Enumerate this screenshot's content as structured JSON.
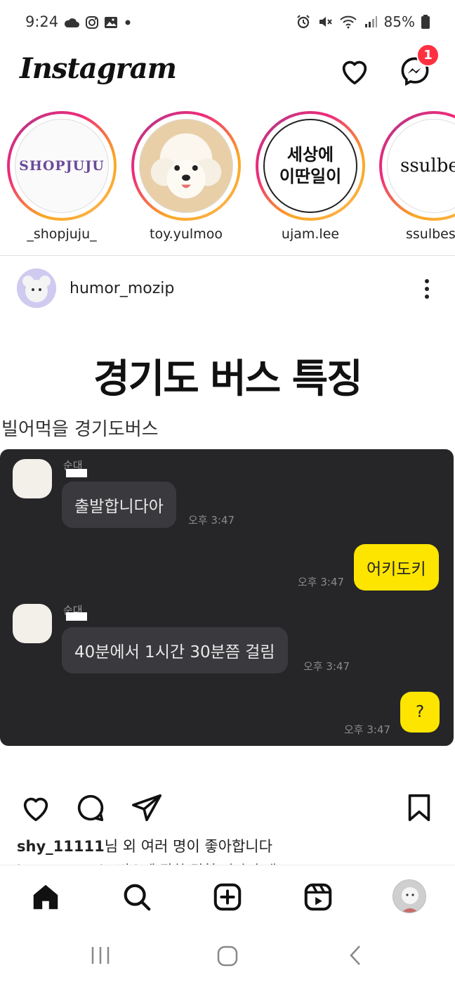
{
  "status_bar": {
    "time": "9:24",
    "battery": "85%",
    "left_icons": [
      "cloud-icon",
      "instagram-notification-icon",
      "gallery-icon",
      "dot-icon"
    ],
    "right_icons": [
      "alarm-icon",
      "mute-icon",
      "wifi-icon",
      "signal-icon",
      "battery-icon"
    ]
  },
  "header": {
    "brand": "Instagram",
    "notification_count": "1",
    "icons": [
      "heart-icon",
      "messenger-icon"
    ]
  },
  "stories": [
    {
      "name": "_shopjuju_",
      "avatar_text": "SHOPJUJU"
    },
    {
      "name": "toy.yulmoo",
      "avatar_text": ""
    },
    {
      "name": "ujam.lee",
      "avatar_line1": "세상에",
      "avatar_line2": "이딴일이"
    },
    {
      "name": "ssulbes",
      "avatar_text": "ssulbe"
    }
  ],
  "post": {
    "username": "humor_mozip",
    "title": "경기도 버스 특징",
    "subtitle": "빌어먹을 경기도버스",
    "chat": {
      "sender_name_1": "순대",
      "msg1": "출발합니다아",
      "time1": "오후 3:47",
      "reply1": "어키도키",
      "time2": "오후 3:47",
      "sender_name_2": "순대",
      "msg2": "40분에서 1시간 30분쯤 걸림",
      "time3": "오후 3:47",
      "reply2": "?",
      "time4": "오후 3:47"
    },
    "likes_user": "shy_11111",
    "likes_rest": "님 외 여러 명이 좋아합니다",
    "caption_peek": "humor_mozip 버스에 관한 경험 이야기 댓"
  },
  "action_icons": [
    "like-icon",
    "comment-icon",
    "share-icon",
    "bookmark-icon"
  ],
  "bottom_nav": [
    "home-icon",
    "search-icon",
    "create-icon",
    "reels-icon",
    "profile-avatar"
  ],
  "system_nav": [
    "recents-icon",
    "home-button-icon",
    "back-icon"
  ]
}
